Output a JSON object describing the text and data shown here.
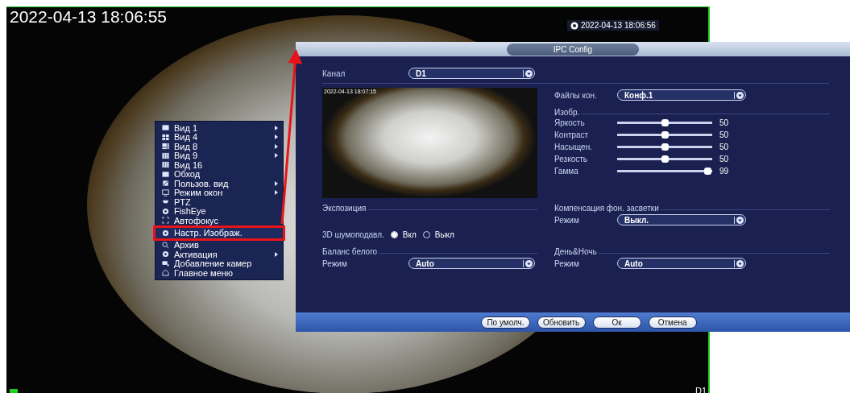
{
  "camera_view": {
    "timestamp": "2022-04-13 18:06:55",
    "clock": "2022-04-13 18:06:56",
    "channel_label": "D1"
  },
  "context_menu": {
    "items": [
      {
        "label": "Вид 1",
        "kind": "view1",
        "submenu": true,
        "selected": false
      },
      {
        "label": "Вид 4",
        "kind": "view4",
        "submenu": true,
        "selected": false
      },
      {
        "label": "Вид 8",
        "kind": "view8",
        "submenu": true,
        "selected": false
      },
      {
        "label": "Вид 9",
        "kind": "view9",
        "submenu": true,
        "selected": false
      },
      {
        "label": "Вид 16",
        "kind": "view16",
        "submenu": false,
        "selected": false
      },
      {
        "label": "Обход",
        "kind": "tour",
        "submenu": false,
        "selected": false
      },
      {
        "label": "Пользов. вид",
        "kind": "custom",
        "submenu": true,
        "selected": false
      },
      {
        "label": "Режим окон",
        "kind": "window",
        "submenu": true,
        "selected": false
      },
      {
        "label": "PTZ",
        "kind": "ptz",
        "submenu": false,
        "selected": false
      },
      {
        "label": "FishEye",
        "kind": "fisheye",
        "submenu": false,
        "selected": false
      },
      {
        "label": "Автофокус",
        "kind": "focus",
        "submenu": false,
        "selected": false
      },
      {
        "label": "Настр. Изображ.",
        "kind": "image",
        "submenu": false,
        "selected": true
      },
      {
        "label": "Архив",
        "kind": "search",
        "submenu": false,
        "selected": false
      },
      {
        "label": "Активация",
        "kind": "activate",
        "submenu": true,
        "selected": false
      },
      {
        "label": "Добавление камер",
        "kind": "add",
        "submenu": false,
        "selected": false
      },
      {
        "label": "Главное меню",
        "kind": "home",
        "submenu": false,
        "selected": false
      }
    ]
  },
  "dialog": {
    "title": "IPC Config",
    "channel": {
      "label": "Канал",
      "value": "D1"
    },
    "preview": {
      "timestamp": "2022-04-13 18:07:15"
    },
    "config_file": {
      "label": "Файлы кон.",
      "value": "Конф.1"
    },
    "image_section": "Изобр.",
    "sliders": [
      {
        "label": "Яркость",
        "level": 0.5,
        "reading": "50"
      },
      {
        "label": "Контраст",
        "level": 0.5,
        "reading": "50"
      },
      {
        "label": "Насыщен.",
        "level": 0.5,
        "reading": "50"
      },
      {
        "label": "Резкость",
        "level": 0.5,
        "reading": "50"
      },
      {
        "label": "Гамма",
        "level": 0.99,
        "reading": "99"
      }
    ],
    "exposure_section": "Экспозиция",
    "backlight": {
      "title": "Компенсация фон. засветки",
      "mode_label": "Режим",
      "value": "Выкл."
    },
    "noise_reduction": {
      "label": "3D шумоподавл.",
      "options": [
        {
          "label": "Вкл",
          "selected": true
        },
        {
          "label": "Выкл",
          "selected": false
        }
      ]
    },
    "white_balance": {
      "title": "Баланс белого",
      "mode_label": "Режим",
      "value": "Auto"
    },
    "day_night": {
      "title": "День&Ночь",
      "mode_label": "Режим",
      "value": "Auto"
    },
    "buttons": [
      "По умолч.",
      "Обновить",
      "Ок",
      "Отмена"
    ]
  }
}
